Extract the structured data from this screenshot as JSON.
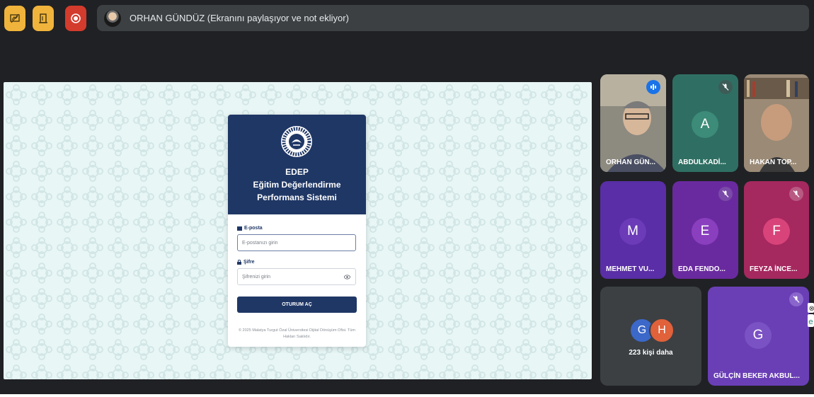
{
  "topbar": {
    "buttons": [
      {
        "name": "whiteboard-icon",
        "color": "#f0b43c"
      },
      {
        "name": "door-icon",
        "color": "#f0b43c"
      },
      {
        "name": "record-icon",
        "color": "#d33b2c"
      }
    ],
    "presenter_text": "ORHAN GÜNDÜZ (Ekranını paylaşıyor ve not ekliyor)"
  },
  "login": {
    "brand_short": "EDEP",
    "brand_line1": "Eğitim Değerlendirme",
    "brand_line2": "Performans Sistemi",
    "email_label": "E-posta",
    "email_placeholder": "E-postanızı girin",
    "password_label": "Şifre",
    "password_placeholder": "Şifrenizi girin",
    "login_button": "OTURUM AÇ",
    "footer_line1": "© 2025 Malatya Turgut Özal Üniversitesi Dijital Dönüşüm Ofisi. Tüm",
    "footer_line2": "Hakları Saklıdır.",
    "header_color": "#1f3765"
  },
  "participants": [
    {
      "name": "ORHAN GÜN...",
      "type": "video",
      "speaking": true
    },
    {
      "name": "ABDULKADİ...",
      "initial": "A",
      "tile_color": "#2f6f63",
      "avatar_color": "#3d8b79",
      "muted": true
    },
    {
      "name": "HAKAN TOP...",
      "type": "video",
      "muted": false
    },
    {
      "name": "MEHMET VU...",
      "initial": "M",
      "tile_color": "#5a2ea6",
      "avatar_color": "#6b3bb8",
      "muted": false
    },
    {
      "name": "EDA FENDO...",
      "initial": "E",
      "tile_color": "#6a2a9f",
      "avatar_color": "#8a3fbf",
      "muted": true
    },
    {
      "name": "FEYZA İNCE...",
      "initial": "F",
      "tile_color": "#a5285f",
      "avatar_color": "#d8447a",
      "muted": true
    },
    {
      "name": "GÜLÇİN BEKER AKBUL...",
      "initial": "G",
      "tile_color": "#6a3fb6",
      "avatar_color": "#7b52c4",
      "muted": true
    }
  ],
  "more_tile": {
    "text": "223 kişi daha",
    "avatars": [
      {
        "initial": "G",
        "color": "#3b68c9"
      },
      {
        "initial": "H",
        "color": "#e0613a"
      }
    ]
  }
}
